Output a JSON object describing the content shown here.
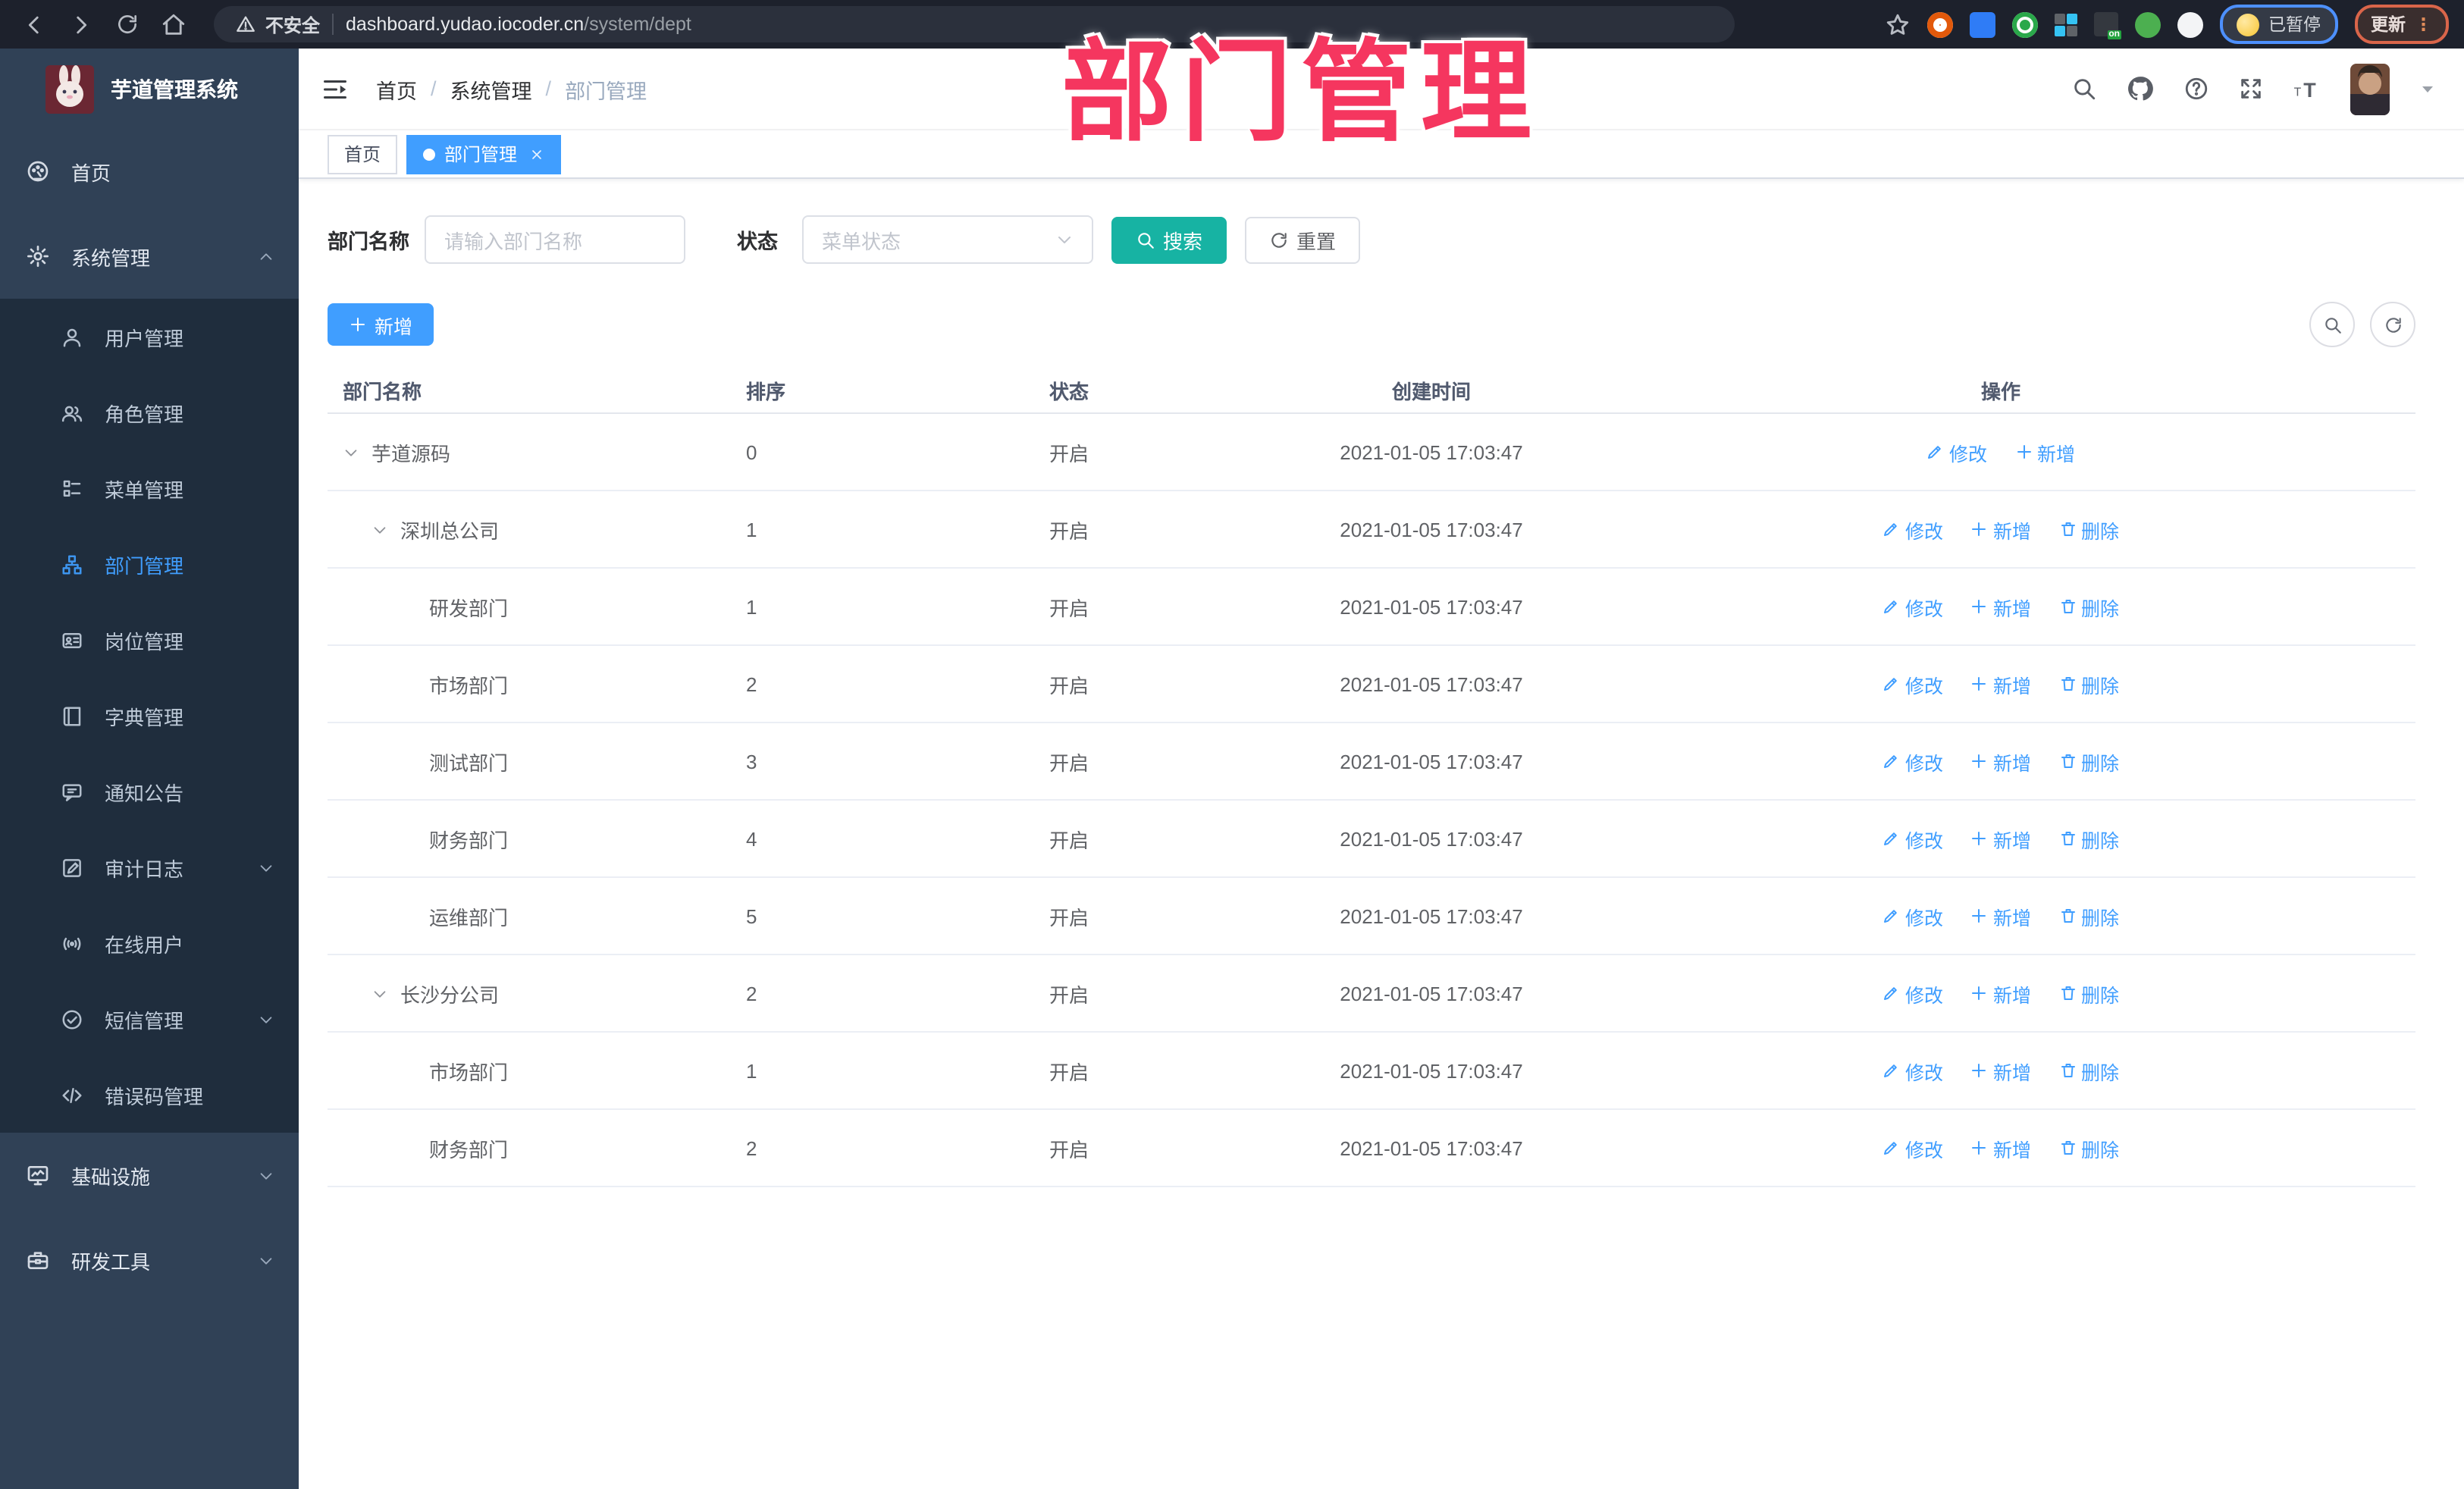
{
  "browser": {
    "security_text": "不安全",
    "url_host": "dashboard.yudao.iocoder.cn",
    "url_path": "/system/dept",
    "profile_label": "已暂停",
    "update_label": "更新",
    "extensions": [
      {
        "name": "extension-icon-orange",
        "color": "#e2590b"
      },
      {
        "name": "extension-icon-blue-gem",
        "color": "#2f7cf6"
      },
      {
        "name": "extension-icon-green",
        "color": "#2aa84a"
      },
      {
        "name": "extension-icon-squares",
        "color": "#5f6368"
      },
      {
        "name": "extension-icon-switch-on",
        "color": "#23a33f"
      },
      {
        "name": "extension-icon-green-key",
        "color": "#4caf50"
      },
      {
        "name": "extension-icon-puzzle",
        "color": "#f3f4f6"
      }
    ]
  },
  "overlay_title": "部门管理",
  "sidebar": {
    "app_title": "芋道管理系统",
    "menu": [
      {
        "label": "首页",
        "icon": "dashboard-icon",
        "type": "top"
      },
      {
        "label": "系统管理",
        "icon": "gear-icon",
        "type": "top",
        "chevron": "up"
      },
      {
        "label": "用户管理",
        "icon": "user-icon",
        "type": "sub"
      },
      {
        "label": "角色管理",
        "icon": "users-icon",
        "type": "sub"
      },
      {
        "label": "菜单管理",
        "icon": "menu-list-icon",
        "type": "sub"
      },
      {
        "label": "部门管理",
        "icon": "org-tree-icon",
        "type": "sub",
        "active": true
      },
      {
        "label": "岗位管理",
        "icon": "id-card-icon",
        "type": "sub"
      },
      {
        "label": "字典管理",
        "icon": "book-icon",
        "type": "sub"
      },
      {
        "label": "通知公告",
        "icon": "megaphone-icon",
        "type": "sub"
      },
      {
        "label": "审计日志",
        "icon": "log-icon",
        "type": "sub",
        "chevron": "down"
      },
      {
        "label": "在线用户",
        "icon": "online-icon",
        "type": "sub"
      },
      {
        "label": "短信管理",
        "icon": "sms-icon",
        "type": "sub",
        "chevron": "down"
      },
      {
        "label": "错误码管理",
        "icon": "code-icon",
        "type": "sub"
      },
      {
        "label": "基础设施",
        "icon": "monitor-icon",
        "type": "top",
        "chevron": "down"
      },
      {
        "label": "研发工具",
        "icon": "toolbox-icon",
        "type": "top",
        "chevron": "down"
      }
    ]
  },
  "header": {
    "breadcrumb": [
      "首页",
      "系统管理",
      "部门管理"
    ]
  },
  "tabs": [
    {
      "label": "首页",
      "active": false,
      "closable": false
    },
    {
      "label": "部门管理",
      "active": true,
      "closable": true
    }
  ],
  "filter": {
    "name_label": "部门名称",
    "name_placeholder": "请输入部门名称",
    "status_label": "状态",
    "status_placeholder": "菜单状态",
    "search_label": "搜索",
    "reset_label": "重置"
  },
  "toolbar": {
    "add_label": "新增"
  },
  "action_icons": {
    "修改": "edit-icon",
    "新增": "plus-icon",
    "删除": "trash-icon"
  },
  "table": {
    "columns": [
      "部门名称",
      "排序",
      "状态",
      "创建时间",
      "操作"
    ],
    "rows": [
      {
        "name": "芋道源码",
        "level": 0,
        "expandable": true,
        "sort": "0",
        "status": "开启",
        "created": "2021-01-05 17:03:47",
        "actions": [
          "修改",
          "新增"
        ]
      },
      {
        "name": "深圳总公司",
        "level": 1,
        "expandable": true,
        "sort": "1",
        "status": "开启",
        "created": "2021-01-05 17:03:47",
        "actions": [
          "修改",
          "新增",
          "删除"
        ]
      },
      {
        "name": "研发部门",
        "level": 2,
        "expandable": false,
        "sort": "1",
        "status": "开启",
        "created": "2021-01-05 17:03:47",
        "actions": [
          "修改",
          "新增",
          "删除"
        ]
      },
      {
        "name": "市场部门",
        "level": 2,
        "expandable": false,
        "sort": "2",
        "status": "开启",
        "created": "2021-01-05 17:03:47",
        "actions": [
          "修改",
          "新增",
          "删除"
        ]
      },
      {
        "name": "测试部门",
        "level": 2,
        "expandable": false,
        "sort": "3",
        "status": "开启",
        "created": "2021-01-05 17:03:47",
        "actions": [
          "修改",
          "新增",
          "删除"
        ]
      },
      {
        "name": "财务部门",
        "level": 2,
        "expandable": false,
        "sort": "4",
        "status": "开启",
        "created": "2021-01-05 17:03:47",
        "actions": [
          "修改",
          "新增",
          "删除"
        ]
      },
      {
        "name": "运维部门",
        "level": 2,
        "expandable": false,
        "sort": "5",
        "status": "开启",
        "created": "2021-01-05 17:03:47",
        "actions": [
          "修改",
          "新增",
          "删除"
        ]
      },
      {
        "name": "长沙分公司",
        "level": 1,
        "expandable": true,
        "sort": "2",
        "status": "开启",
        "created": "2021-01-05 17:03:47",
        "actions": [
          "修改",
          "新增",
          "删除"
        ]
      },
      {
        "name": "市场部门",
        "level": 2,
        "expandable": false,
        "sort": "1",
        "status": "开启",
        "created": "2021-01-05 17:03:47",
        "actions": [
          "修改",
          "新增",
          "删除"
        ]
      },
      {
        "name": "财务部门",
        "level": 2,
        "expandable": false,
        "sort": "2",
        "status": "开启",
        "created": "2021-01-05 17:03:47",
        "actions": [
          "修改",
          "新增",
          "删除"
        ]
      }
    ]
  },
  "colors": {
    "primary": "#409eff",
    "search_button": "#17b3a3",
    "overlay_pink": "#f5365f",
    "sidebar_bg": "#304156",
    "submenu_bg": "#1f2d3d"
  }
}
